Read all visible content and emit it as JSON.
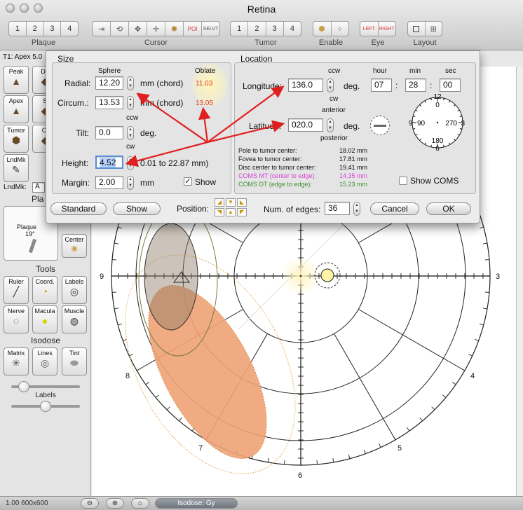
{
  "window": {
    "title": "Retina"
  },
  "toolbar": {
    "plaque": {
      "items": [
        "1",
        "2",
        "3",
        "4"
      ],
      "label": "Plaque"
    },
    "cursor": {
      "label": "Cursor",
      "icons": [
        "arrow-cursor-icon",
        "rotate-cursor-icon",
        "move-cursor-icon",
        "cross-cursor-icon",
        "gear-cursor-icon",
        "poi-cursor-icon",
        "selvt-cursor-icon"
      ],
      "poi_text": "POI",
      "selvt_text": "SELVT"
    },
    "tumor": {
      "items": [
        "1",
        "2",
        "3",
        "4"
      ],
      "label": "Tumor"
    },
    "enable": {
      "label": "Enable"
    },
    "eye": {
      "label": "Eye",
      "left": "LEFT",
      "right": "RIGHT"
    },
    "layout": {
      "label": "Layout"
    }
  },
  "palette": {
    "t1_label": "T1: Apex 5.0",
    "tools_row1": [
      "Peak",
      "Do"
    ],
    "tools_row2": [
      "Apex",
      "S"
    ],
    "tools_row3": [
      "Tumor",
      "Cl"
    ],
    "landmark_btn": "LndMk",
    "landmark_label": "LndMk:",
    "landmark_value": "A",
    "plaque_heading": "Pla",
    "plaque_preview_label": "Plaque",
    "plaque_preview_angle": "19°",
    "center_btn": "Center",
    "tools_heading": "Tools",
    "tools": [
      "Ruler",
      "Coord.",
      "Labels",
      "Nerve",
      "Macula",
      "Muscle"
    ],
    "isodose_heading": "Isodose",
    "isodose_tools": [
      "Matrix",
      "Lines",
      "Tint"
    ],
    "labels_slider_label": "Labels",
    "slider1_level": 0.12,
    "slider2_level": 0.5
  },
  "dialog": {
    "size": {
      "heading": "Size",
      "col_sphere": "Sphere",
      "col_oblate": "Oblate",
      "radial_label": "Radial:",
      "radial_value": "12.20",
      "radial_unit": "mm (chord)",
      "radial_oblate": "11.03",
      "circum_label": "Circum.:",
      "circum_value": "13.53",
      "circum_unit": "mm (chord)",
      "circum_oblate": "13.05",
      "tilt_ccw": "ccw",
      "tilt_label": "Tilt:",
      "tilt_value": "0.0",
      "tilt_unit": "deg.",
      "tilt_cw": "cw",
      "height_label": "Height:",
      "height_value": "4.52",
      "height_range": "0.01 to 22.87 mm)",
      "margin_label": "Margin:",
      "margin_value": "2.00",
      "margin_unit": "mm",
      "show_label": "Show",
      "show_checked": true
    },
    "location": {
      "heading": "Location",
      "ccw": "ccw",
      "hour_head": "hour",
      "min_head": "min",
      "sec_head": "sec",
      "longitude_label": "Longitude:",
      "longitude_value": "136.0",
      "longitude_unit": "deg.",
      "hour_value": "07",
      "min_value": "28",
      "sec_value": "00",
      "cw": "cw",
      "anterior": "anterior",
      "latitude_label": "Latitude:",
      "latitude_value": "020.0",
      "latitude_unit": "deg.",
      "posterior": "posterior",
      "dial_labels": [
        "12",
        "0",
        "3",
        "270",
        "6",
        "180",
        "9",
        "90"
      ],
      "measures": [
        {
          "label": "Pole to tumor center:",
          "value": "18.02 mm",
          "color": "#111111"
        },
        {
          "label": "Fovea to tumor center:",
          "value": "17.81 mm",
          "color": "#111111"
        },
        {
          "label": "Disc center to tumor center:",
          "value": "19.41 mm",
          "color": "#111111"
        },
        {
          "label": "COMS MT (center to edge):",
          "value": "14.35 mm",
          "color": "#d63fd6"
        },
        {
          "label": "COMS DT (edge to edge):",
          "value": "15.23 mm",
          "color": "#3f8f2f"
        }
      ],
      "show_coms_label": "Show COMS",
      "show_coms_checked": false
    },
    "footer": {
      "standard_btn": "Standard",
      "show_btn": "Show",
      "position_label": "Position:",
      "edges_label": "Num. of edges:",
      "edges_value": "36",
      "cancel_btn": "Cancel",
      "ok_btn": "OK"
    }
  },
  "chart_labels": {
    "n3": "3",
    "n4": "4",
    "n5": "5",
    "n6": "6",
    "n7": "7",
    "n8": "8",
    "n9": "9"
  },
  "status": {
    "zoom_text": "1.00 600x600",
    "isodose_label": "Isodose: Gy"
  },
  "colors": {
    "tumor_fill": "#eea274",
    "tumor_edge": "#d9a24a",
    "arrow": "#e02020",
    "oblate_text": "#e23b1f",
    "selection": "#b5d3ff"
  }
}
